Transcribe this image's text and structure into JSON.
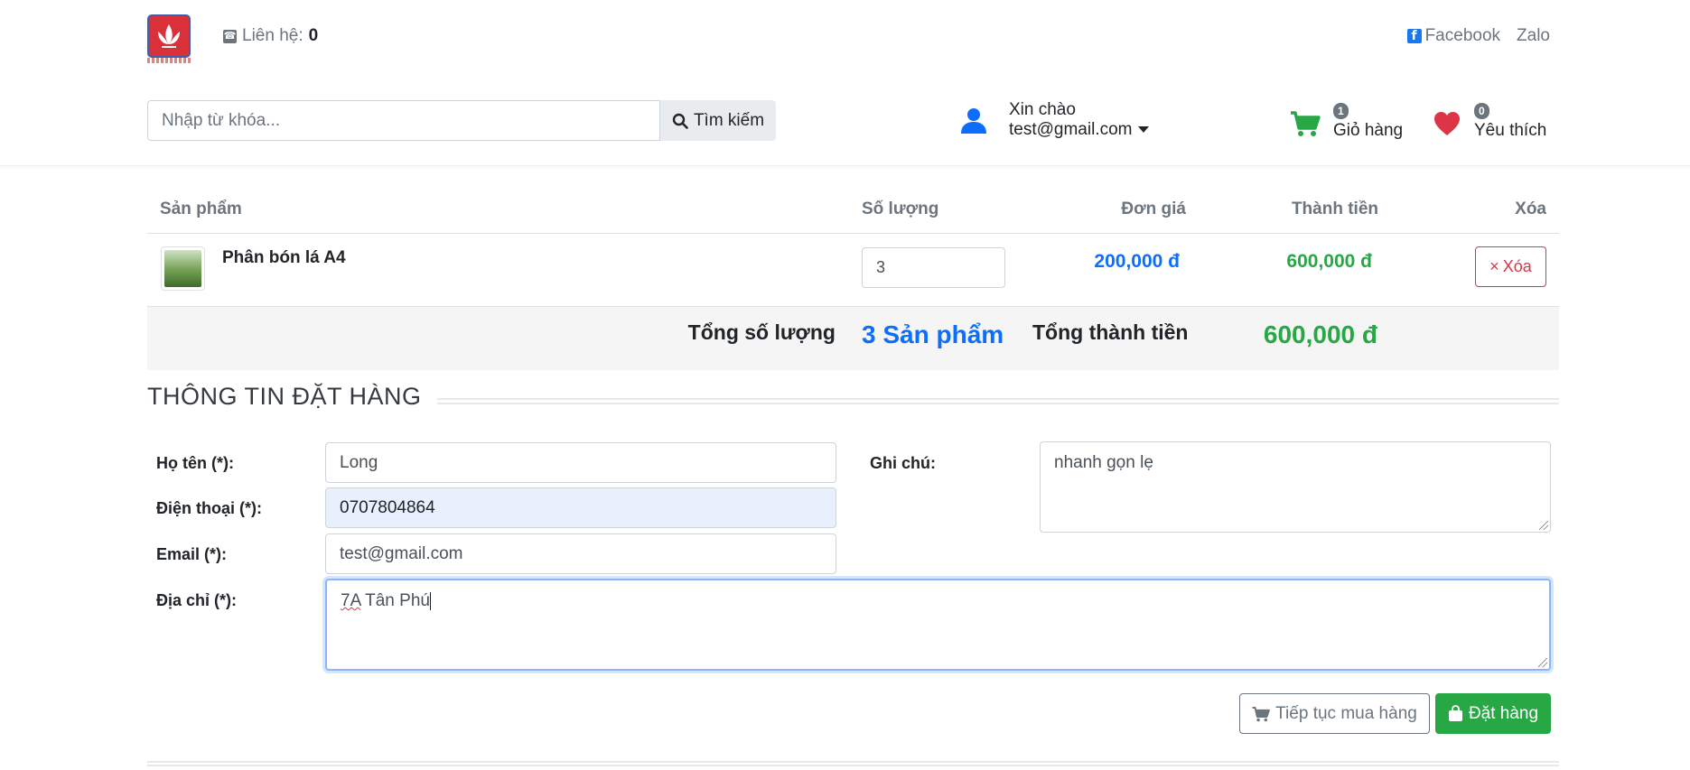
{
  "header": {
    "contact_label": "Liên hệ:",
    "contact_value": "0",
    "facebook_label": "Facebook",
    "zalo_label": "Zalo",
    "search_placeholder": "Nhập từ khóa...",
    "search_button": "Tìm kiếm",
    "greeting": "Xin chào",
    "user_email": "test@gmail.com",
    "cart_count": "1",
    "cart_label": "Giỏ hàng",
    "wishlist_count": "0",
    "wishlist_label": "Yêu thích"
  },
  "cart": {
    "columns": [
      "Sản phẩm",
      "Số lượng",
      "Đơn giá",
      "Thành tiền",
      "Xóa"
    ],
    "items": [
      {
        "name": "Phân bón lá A4",
        "quantity": "3",
        "unit_price": "200,000 đ",
        "line_total": "600,000 đ",
        "delete_label": "Xóa"
      }
    ],
    "total_qty_label": "Tổng số lượng",
    "total_qty_value": "3 Sản phẩm",
    "total_amount_label": "Tổng thành tiền",
    "total_amount_value": "600,000 đ"
  },
  "order_form": {
    "title": "THÔNG TIN ĐẶT HÀNG",
    "name_label": "Họ tên (*):",
    "name_value": "Long",
    "phone_label": "Điện thoại (*):",
    "phone_value": "0707804864",
    "email_label": "Email (*):",
    "email_value": "test@gmail.com",
    "note_label": "Ghi chú:",
    "note_value": "nhanh gọn lẹ",
    "address_label": "Địa chỉ (*):",
    "address_value_part1": "7A",
    "address_value_part2": " Tân Phú",
    "continue_button": "Tiếp tục mua hàng",
    "order_button": "Đặt hàng"
  },
  "colors": {
    "primary": "#0d6efd",
    "success": "#28a745",
    "danger": "#dc3545",
    "muted": "#6c757d",
    "brand_red": "#d9303a"
  },
  "icons": {
    "phone": "phone-icon",
    "facebook": "facebook-icon",
    "search": "search-icon",
    "user": "user-icon",
    "cart": "cart-icon",
    "heart": "heart-icon",
    "close": "close-icon",
    "bag": "shopping-bag-icon"
  }
}
